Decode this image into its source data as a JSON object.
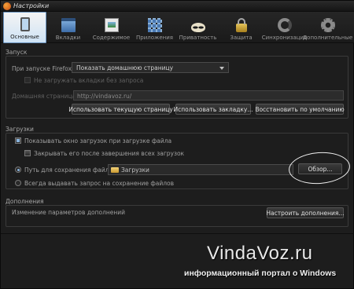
{
  "window": {
    "title": "Настройки"
  },
  "tabs": [
    {
      "label": "Основные",
      "icon": "general-icon",
      "active": true
    },
    {
      "label": "Вкладки",
      "icon": "tabs-icon",
      "active": false
    },
    {
      "label": "Содержимое",
      "icon": "content-icon",
      "active": false
    },
    {
      "label": "Приложения",
      "icon": "applications-icon",
      "active": false
    },
    {
      "label": "Приватность",
      "icon": "privacy-mask-icon",
      "active": false
    },
    {
      "label": "Защита",
      "icon": "lock-icon",
      "active": false
    },
    {
      "label": "Синхронизация",
      "icon": "sync-icon",
      "active": false
    },
    {
      "label": "Дополнительные",
      "icon": "gear-icon",
      "active": false
    }
  ],
  "startup": {
    "section_title": "Запуск",
    "on_start_label": "При запуске Firefox:",
    "on_start_value": "Показать домашнюю страницу",
    "no_load_tabs_label": "Не загружать вкладки без запроса",
    "homepage_label": "Домашняя страница:",
    "homepage_value": "http://vindavoz.ru/",
    "use_current_button": "Использовать текущую страницу",
    "use_bookmark_button": "Использовать закладку...",
    "restore_default_button": "Восстановить по умолчанию"
  },
  "downloads": {
    "section_title": "Загрузки",
    "show_window_label": "Показывать окно загрузок при загрузке файла",
    "close_after_label": "Закрывать его после завершения всех загрузок",
    "save_path_label": "Путь для сохранения файлов",
    "save_path_value": "Загрузки",
    "browse_button": "Обзор...",
    "always_ask_label": "Всегда выдавать запрос на сохранение файлов"
  },
  "addons": {
    "section_title": "Дополнения",
    "description": "Изменение параметров дополнений",
    "configure_button": "Настроить дополнения..."
  },
  "watermark": {
    "title": "VindaVoz.ru",
    "subtitle": "информационный портал о Windows"
  }
}
